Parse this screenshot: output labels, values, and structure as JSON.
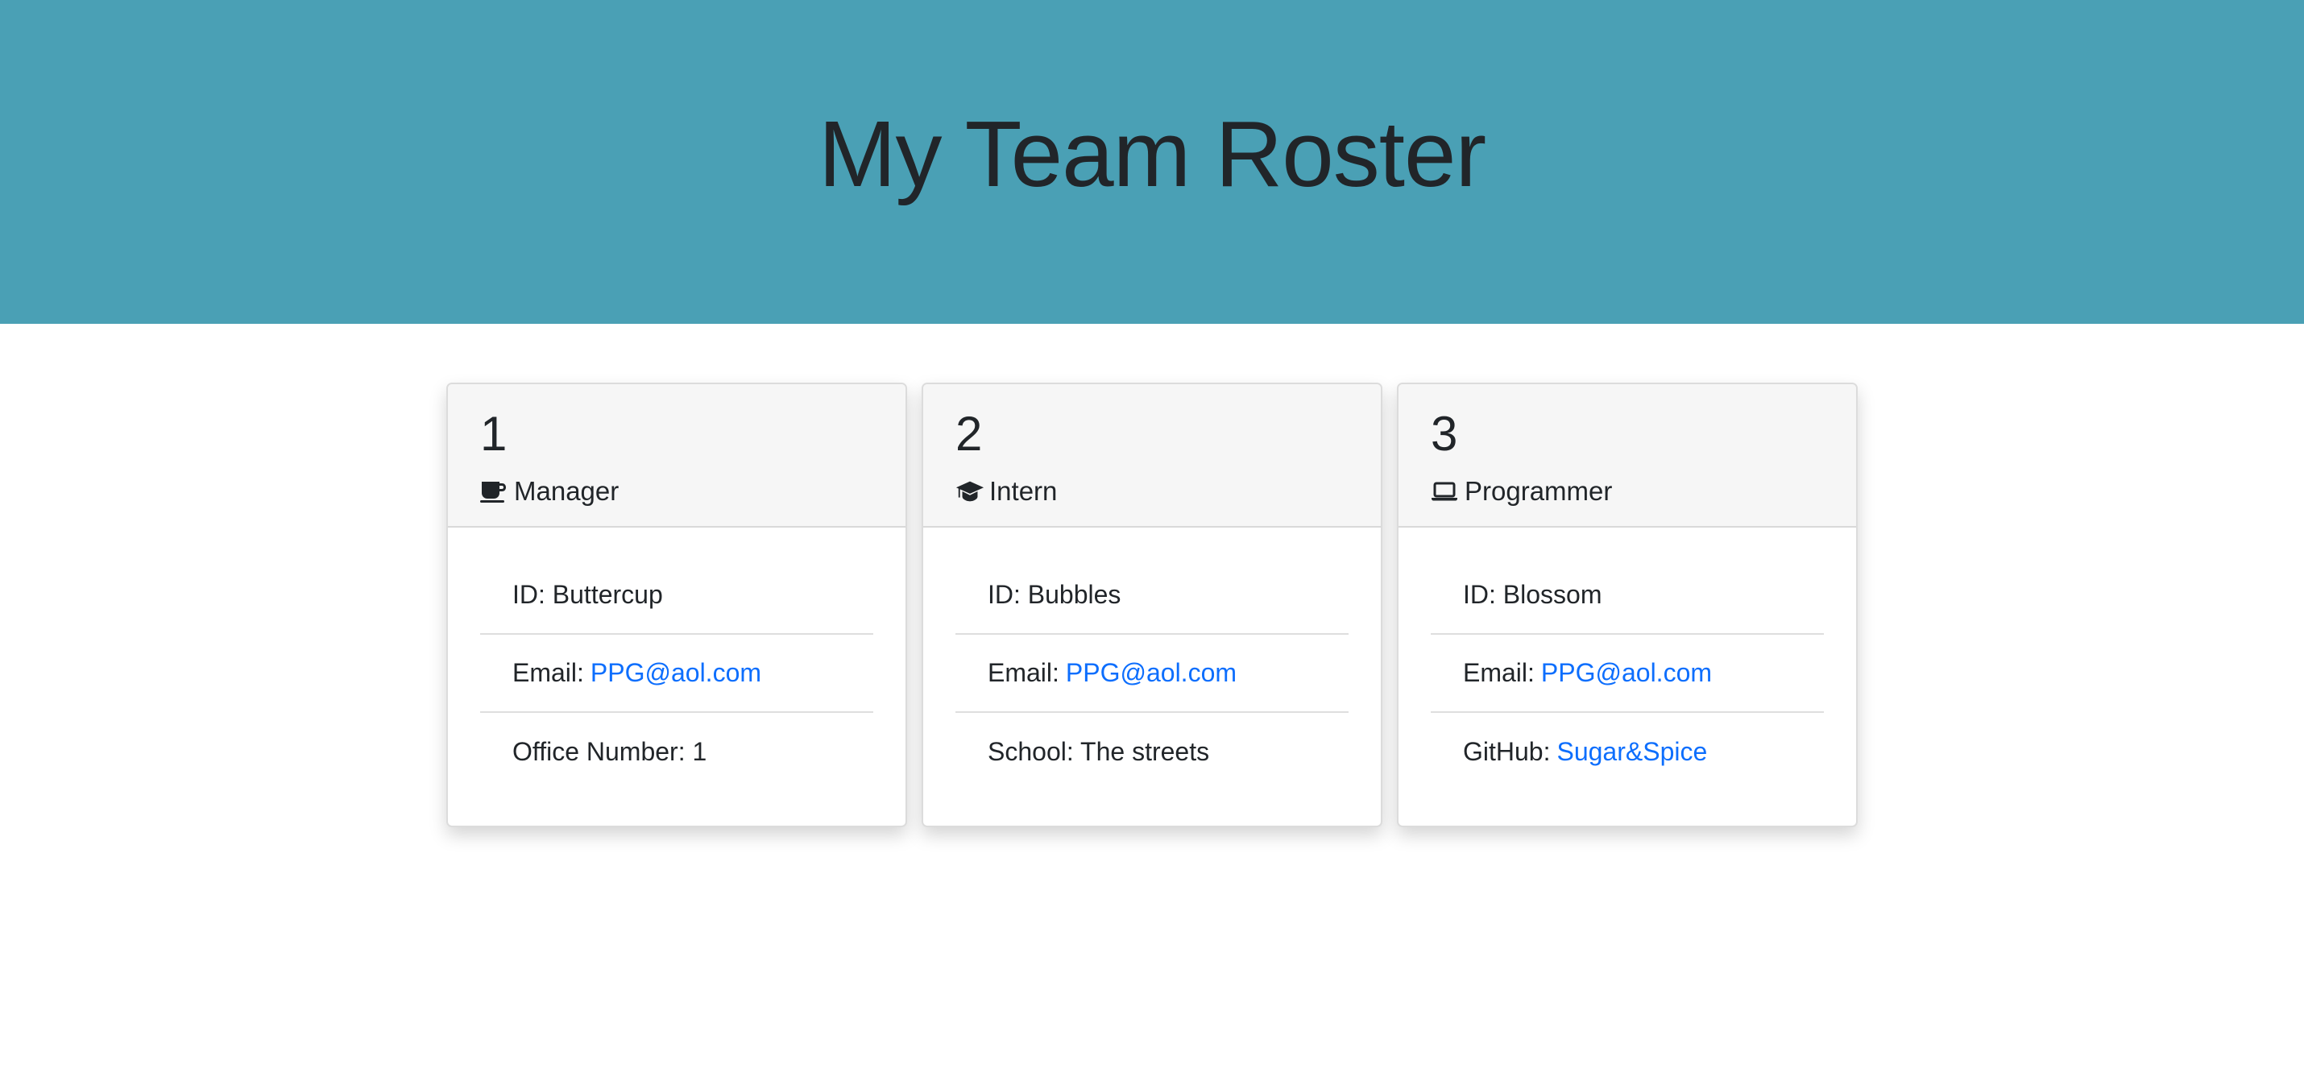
{
  "header": {
    "title": "My Team Roster"
  },
  "cards": [
    {
      "number": "1",
      "role": "Manager",
      "icon": "coffee-icon",
      "id_text": "ID: Buttercup",
      "email_label": "Email:",
      "email_link": "PPG@aol.com",
      "extra_label": "Office Number: 1",
      "extra_link": ""
    },
    {
      "number": "2",
      "role": "Intern",
      "icon": "graduation-cap-icon",
      "id_text": "ID: Bubbles",
      "email_label": "Email:",
      "email_link": "PPG@aol.com",
      "extra_label": "School: The streets",
      "extra_link": ""
    },
    {
      "number": "3",
      "role": "Programmer",
      "icon": "laptop-icon",
      "id_text": "ID: Blossom",
      "email_label": "Email:",
      "email_link": "PPG@aol.com",
      "extra_label": "GitHub:",
      "extra_link": "Sugar&Spice"
    }
  ],
  "colors": {
    "header_bg": "#4aa0b5",
    "link": "#0d6efd",
    "card_header_bg": "#f6f6f6"
  }
}
